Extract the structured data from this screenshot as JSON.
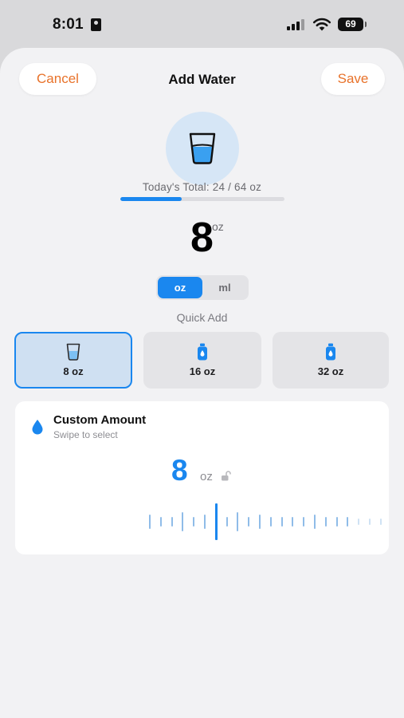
{
  "status": {
    "time": "8:01",
    "battery": "69"
  },
  "header": {
    "cancel_label": "Cancel",
    "title": "Add Water",
    "save_label": "Save"
  },
  "summary": {
    "total_text": "Today's Total: 24 / 64 oz",
    "progress": 0.375
  },
  "amount": {
    "value": "8",
    "unit": "oz"
  },
  "unit_toggle": {
    "options": [
      "oz",
      "ml"
    ],
    "selected": "oz"
  },
  "quick_add": {
    "label": "Quick Add",
    "items": [
      {
        "label": "8 oz",
        "icon": "glass-icon",
        "selected": true
      },
      {
        "label": "16 oz",
        "icon": "bottle-icon",
        "selected": false
      },
      {
        "label": "32 oz",
        "icon": "bottle-icon",
        "selected": false
      }
    ]
  },
  "custom": {
    "title": "Custom Amount",
    "subtitle": "Swipe to select",
    "value": "8",
    "unit": "oz",
    "icon": "water-drop-icon"
  },
  "colors": {
    "accent": "#1a87ef",
    "action": "#e8722a",
    "sheet": "#f2f2f4"
  }
}
